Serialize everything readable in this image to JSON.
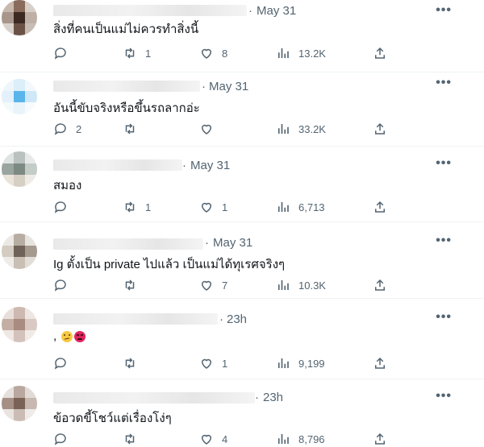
{
  "replies": [
    {
      "date": "May 31",
      "text": "สิ่งที่คนเป็นแม่ไม่ควรทำสิ่งนี้",
      "reply_count": "",
      "retweet_count": "1",
      "like_count": "8",
      "view_count": "13.2K"
    },
    {
      "date": "May 31",
      "text": "อันนี้ขับจริงหรือขึ้นรถลากอ่ะ",
      "reply_count": "2",
      "retweet_count": "",
      "like_count": "",
      "view_count": "33.2K"
    },
    {
      "date": "May 31",
      "text": "สมอง",
      "reply_count": "",
      "retweet_count": "1",
      "like_count": "1",
      "view_count": "6,713"
    },
    {
      "date": "May 31",
      "text": "Ig ตั้งเป็น private ไปแล้ว เป็นแม่ได้ทุเรศจริงๆ",
      "reply_count": "",
      "retweet_count": "",
      "like_count": "7",
      "view_count": "10.3K"
    },
    {
      "date": "23h",
      "text": ",",
      "reply_count": "",
      "retweet_count": "",
      "like_count": "1",
      "view_count": "9,199"
    },
    {
      "date": "23h",
      "text": "ข้อวดขี้โชว์แต่เรื่องโง่ๆ",
      "reply_count": "",
      "retweet_count": "",
      "like_count": "4",
      "view_count": "8,796"
    }
  ],
  "separator": "·",
  "more_glyph": "•••",
  "icons": [
    "reply-icon",
    "retweet-icon",
    "like-icon",
    "views-icon",
    "share-icon",
    "more-icon",
    "confused-face-emoji",
    "angry-face-emoji"
  ],
  "colors": {
    "text": "#0f1419",
    "secondary": "#536471",
    "divider": "#eff3f4",
    "confused_emoji": "#f7c843",
    "angry_emoji": "#e0245e"
  }
}
